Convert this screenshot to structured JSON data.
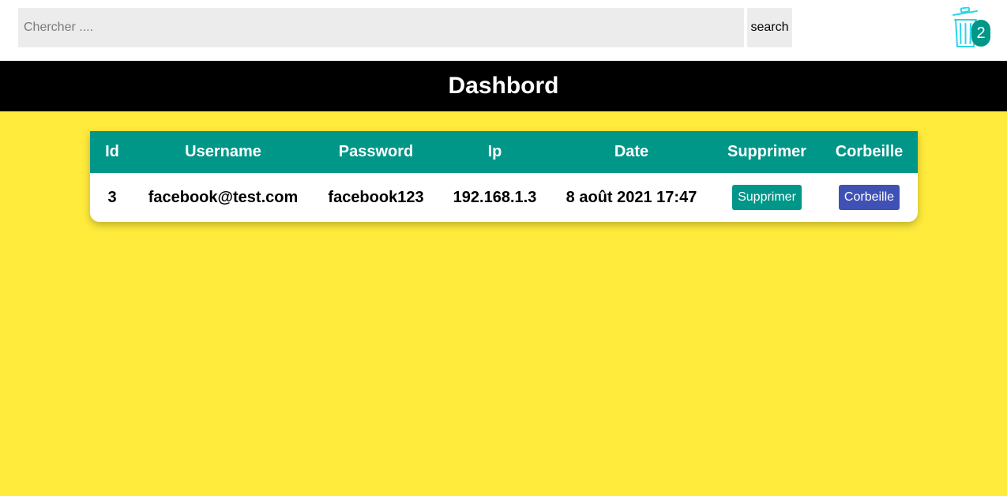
{
  "search": {
    "placeholder": "Chercher ....",
    "value": "",
    "button_label": "search"
  },
  "trash": {
    "icon": "trash-icon",
    "count": "2",
    "icon_color": "#29d6e6",
    "badge_color": "#009688"
  },
  "header": {
    "title": "Dashbord"
  },
  "table": {
    "columns": [
      "Id",
      "Username",
      "Password",
      "Ip",
      "Date",
      "Supprimer",
      "Corbeille"
    ],
    "rows": [
      {
        "id": "3",
        "username": "facebook@test.com",
        "password": "facebook123",
        "ip": "192.168.1.3",
        "date": "8 août 2021 17:47",
        "delete_label": "Supprimer",
        "trash_label": "Corbeille"
      }
    ]
  },
  "colors": {
    "background": "#ffeb3b",
    "header_bar": "#000000",
    "table_header": "#009688",
    "delete_button": "#009688",
    "trash_button": "#3f51b5"
  }
}
